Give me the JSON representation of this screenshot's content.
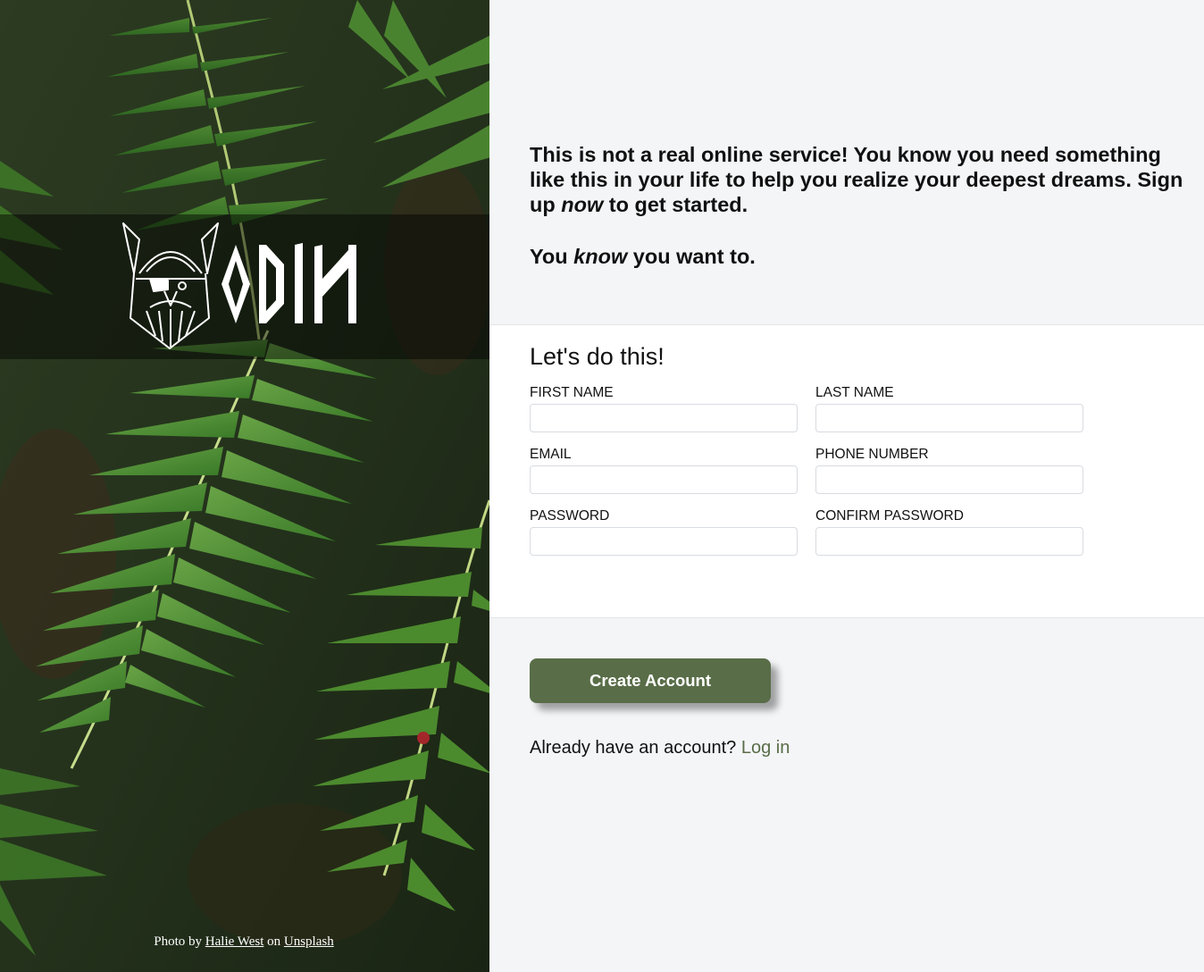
{
  "hero": {
    "brand": "ODIN",
    "credit": {
      "prefix": "Photo by",
      "author": "Halie West",
      "middle": "on",
      "site": "Unsplash"
    }
  },
  "intro": {
    "line1_before": "This is not a real online service! You know you need something like this in your life to help you realize your deepest dreams. Sign up",
    "line1_emphasis": "now",
    "line1_after": "to get started.",
    "line2_before": "You",
    "line2_emphasis": "know",
    "line2_after": "you want to."
  },
  "form": {
    "title": "Let's do this!",
    "fields": {
      "first_name": "FIRST NAME",
      "last_name": "LAST NAME",
      "email": "EMAIL",
      "phone": "PHONE NUMBER",
      "password": "PASSWORD",
      "confirm_password": "CONFIRM PASSWORD"
    }
  },
  "actions": {
    "create_label": "Create Account",
    "login_prompt": "Already have an account?",
    "login_link": "Log in"
  },
  "colors": {
    "accent": "#596d48",
    "panel_bg": "#f4f5f7",
    "form_bg": "#ffffff"
  }
}
